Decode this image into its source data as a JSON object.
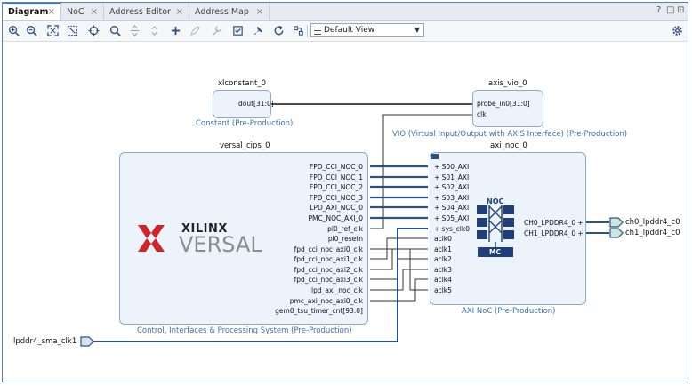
{
  "tabs": [
    {
      "label": "Diagram",
      "active": true
    },
    {
      "label": "NoC"
    },
    {
      "label": "Address Editor"
    },
    {
      "label": "Address Map"
    }
  ],
  "window_controls": {
    "help": "?",
    "restore": "□",
    "maximize": "⊡"
  },
  "toolbar": {
    "view_selector": "Default View"
  },
  "blocks": {
    "xlconstant": {
      "name": "xlconstant_0",
      "subtitle": "Constant (Pre-Production)",
      "pin": "dout[31:0]"
    },
    "vio": {
      "name": "axis_vio_0",
      "subtitle": "VIO (Virtual Input/Output with AXIS Interface) (Pre-Production)",
      "pins": [
        "probe_in0[31:0]",
        "clk"
      ]
    },
    "cips": {
      "name": "versal_cips_0",
      "subtitle": "Control, Interfaces & Processing System (Pre-Production)",
      "logo_top": "XILINX",
      "logo_bottom": "VERSAL",
      "pins": [
        "FPD_CCI_NOC_0",
        "FPD_CCI_NOC_1",
        "FPD_CCI_NOC_2",
        "FPD_CCI_NOC_3",
        "LPD_AXI_NOC_0",
        "PMC_NOC_AXI_0",
        "pl0_ref_clk",
        "pl0_resetn",
        "fpd_cci_noc_axi0_clk",
        "fpd_cci_noc_axi1_clk",
        "fpd_cci_noc_axi2_clk",
        "fpd_cci_noc_axi3_clk",
        "lpd_axi_noc_clk",
        "pmc_axi_noc_axi0_clk",
        "gem0_tsu_timer_cnt[93:0]"
      ]
    },
    "noc": {
      "name": "axi_noc_0",
      "subtitle": "AXI NoC (Pre-Production)",
      "left_pins": [
        "S00_AXI",
        "S01_AXI",
        "S02_AXI",
        "S03_AXI",
        "S04_AXI",
        "S05_AXI",
        "sys_clk0",
        "aclk0",
        "aclk1",
        "aclk2",
        "aclk3",
        "aclk4",
        "aclk5"
      ],
      "right_pins": [
        "CH0_LPDDR4_0",
        "CH1_LPDDR4_0"
      ],
      "icon_top": "NOC",
      "icon_bottom": "MC"
    }
  },
  "ports": {
    "in": "lpddr4_sma_clk1",
    "out": [
      "ch0_lpddr4_c0",
      "ch1_lpddr4_c0"
    ]
  }
}
